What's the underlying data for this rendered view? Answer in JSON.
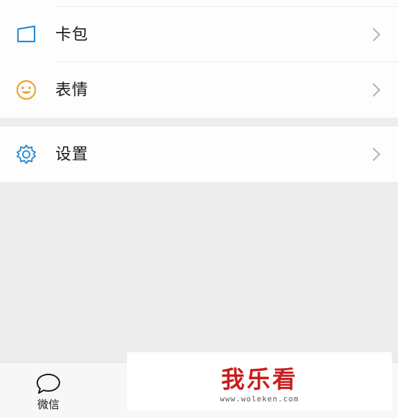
{
  "menu": {
    "items": [
      {
        "label": "卡包",
        "icon": "card-wallet-icon"
      },
      {
        "label": "表情",
        "icon": "emoji-smile-icon"
      },
      {
        "label": "设置",
        "icon": "gear-icon"
      }
    ]
  },
  "tabbar": {
    "tabs": [
      {
        "label": "微信",
        "icon": "chat-bubble-icon"
      }
    ]
  },
  "watermark": {
    "brand": "我乐看",
    "url": "www.woleken.com"
  },
  "colors": {
    "icon_blue": "#2b8bd6",
    "icon_orange": "#f0a030",
    "page_background": "#ededed",
    "cell_background": "#fdfdfd",
    "brand_red": "#c81e1e"
  }
}
